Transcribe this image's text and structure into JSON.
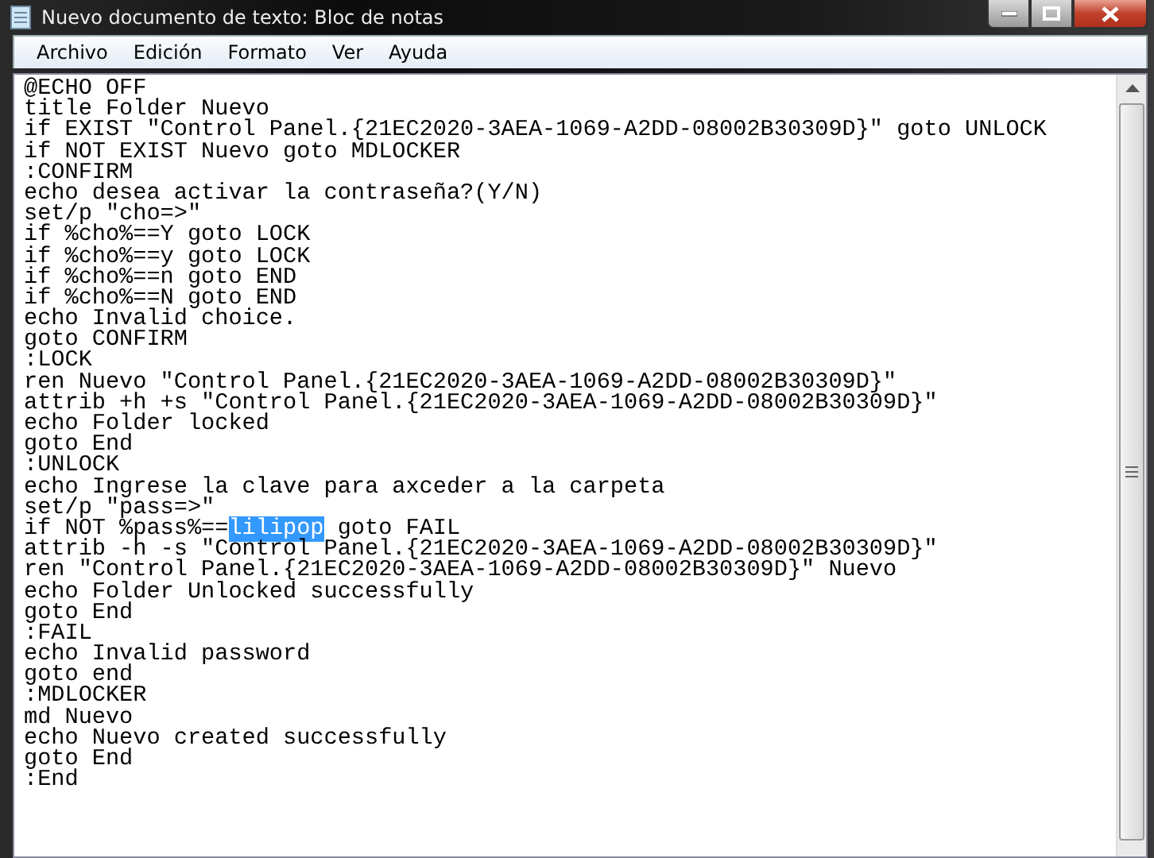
{
  "window": {
    "title": "Nuevo documento de texto: Bloc de notas"
  },
  "menu": [
    "Archivo",
    "Edición",
    "Formato",
    "Ver",
    "Ayuda"
  ],
  "lines": [
    {
      "kind": "plain",
      "text": "@ECHO OFF"
    },
    {
      "kind": "plain",
      "text": "title Folder Nuevo"
    },
    {
      "kind": "plain",
      "text": "if EXIST \"Control Panel.{21EC2020-3AEA-1069-A2DD-08002B30309D}\" goto UNLOCK"
    },
    {
      "kind": "plain",
      "text": "if NOT EXIST Nuevo goto MDLOCKER"
    },
    {
      "kind": "plain",
      "text": ":CONFIRM"
    },
    {
      "kind": "plain",
      "text": "echo desea activar la contraseña?(Y/N)"
    },
    {
      "kind": "plain",
      "text": "set/p \"cho=>\""
    },
    {
      "kind": "plain",
      "text": "if %cho%==Y goto LOCK"
    },
    {
      "kind": "plain",
      "text": "if %cho%==y goto LOCK"
    },
    {
      "kind": "plain",
      "text": "if %cho%==n goto END"
    },
    {
      "kind": "plain",
      "text": "if %cho%==N goto END"
    },
    {
      "kind": "plain",
      "text": "echo Invalid choice."
    },
    {
      "kind": "plain",
      "text": "goto CONFIRM"
    },
    {
      "kind": "plain",
      "text": ":LOCK"
    },
    {
      "kind": "plain",
      "text": "ren Nuevo \"Control Panel.{21EC2020-3AEA-1069-A2DD-08002B30309D}\""
    },
    {
      "kind": "plain",
      "text": "attrib +h +s \"Control Panel.{21EC2020-3AEA-1069-A2DD-08002B30309D}\""
    },
    {
      "kind": "plain",
      "text": "echo Folder locked"
    },
    {
      "kind": "plain",
      "text": "goto End"
    },
    {
      "kind": "plain",
      "text": ":UNLOCK"
    },
    {
      "kind": "plain",
      "text": "echo Ingrese la clave para axceder a la carpeta"
    },
    {
      "kind": "plain",
      "text": "set/p \"pass=>\""
    },
    {
      "kind": "selection",
      "before": "if NOT %pass%==",
      "selected": "lilipop",
      "after": " goto FAIL"
    },
    {
      "kind": "plain",
      "text": "attrib -h -s \"Control Panel.{21EC2020-3AEA-1069-A2DD-08002B30309D}\""
    },
    {
      "kind": "plain",
      "text": "ren \"Control Panel.{21EC2020-3AEA-1069-A2DD-08002B30309D}\" Nuevo"
    },
    {
      "kind": "plain",
      "text": "echo Folder Unlocked successfully"
    },
    {
      "kind": "plain",
      "text": "goto End"
    },
    {
      "kind": "plain",
      "text": ":FAIL"
    },
    {
      "kind": "plain",
      "text": "echo Invalid password"
    },
    {
      "kind": "plain",
      "text": "goto end"
    },
    {
      "kind": "plain",
      "text": ":MDLOCKER"
    },
    {
      "kind": "plain",
      "text": "md Nuevo"
    },
    {
      "kind": "plain",
      "text": "echo Nuevo created successfully"
    },
    {
      "kind": "plain",
      "text": "goto End"
    },
    {
      "kind": "plain",
      "text": ":End"
    }
  ]
}
